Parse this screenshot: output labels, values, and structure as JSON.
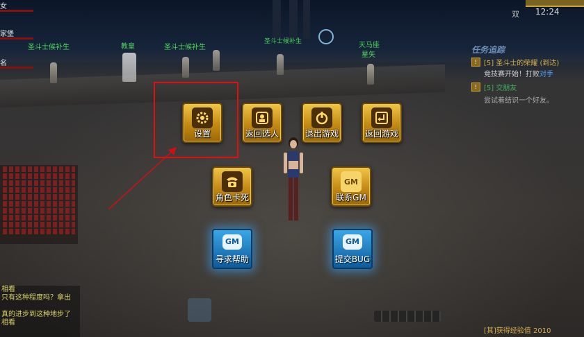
{
  "left_hud": {
    "labels": [
      "女",
      "家堡",
      "名"
    ]
  },
  "npc_labels": [
    "圣斗士候补生",
    "教皇",
    "圣斗士候补生",
    "圣斗士候补生",
    "天马座",
    "星矢"
  ],
  "clock": "12:24",
  "shuang": "双",
  "quest_panel": {
    "title": "任务追踪",
    "line1_prefix": "[5] 圣斗士的荣耀 (到达)",
    "line2": "竞技赛开始！打败",
    "line2_target": "对手",
    "line3": "[5] 交朋友",
    "line4": "尝试着结识一个好友。"
  },
  "menu": {
    "settings": "设置",
    "back_to_select": "返回选人",
    "exit_game": "退出游戏",
    "return_game": "返回游戏",
    "stuck": "角色卡死",
    "contact_gm": "联系GM",
    "seek_help": "寻求帮助",
    "submit_bug": "提交BUG",
    "gm_badge": "GM"
  },
  "chat": {
    "lines": [
      "相看",
      "只有这种程度吗？拿出",
      "",
      "真的进步到这种地步了",
      "相看"
    ]
  },
  "exp_message": "[其]获得经验值 2010",
  "colors": {
    "gold": "#c48a14",
    "highlight": "#e01010",
    "npc_name": "#4bd85a",
    "gm_blue": "#1a7ac0"
  }
}
